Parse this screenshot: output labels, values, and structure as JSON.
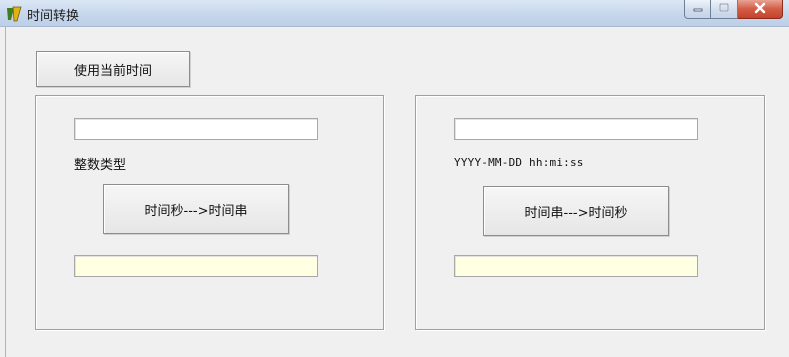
{
  "window": {
    "title": "时间转换",
    "controls": {
      "minimize": "minimize-icon",
      "maximize": "maximize-icon",
      "close": "close-icon"
    }
  },
  "toolbar": {
    "use_current_time_label": "使用当前时间"
  },
  "left_panel": {
    "input_value": "",
    "type_label": "整数类型",
    "convert_button_label": "时间秒--->时间串",
    "output_value": ""
  },
  "right_panel": {
    "input_value": "",
    "format_label": "YYYY-MM-DD hh:mi:ss",
    "convert_button_label": "时间串--->时间秒",
    "output_value": ""
  },
  "colors": {
    "window_bg": "#f0f0f0",
    "output_bg": "#ffffe1",
    "close_button": "#c9503a"
  }
}
